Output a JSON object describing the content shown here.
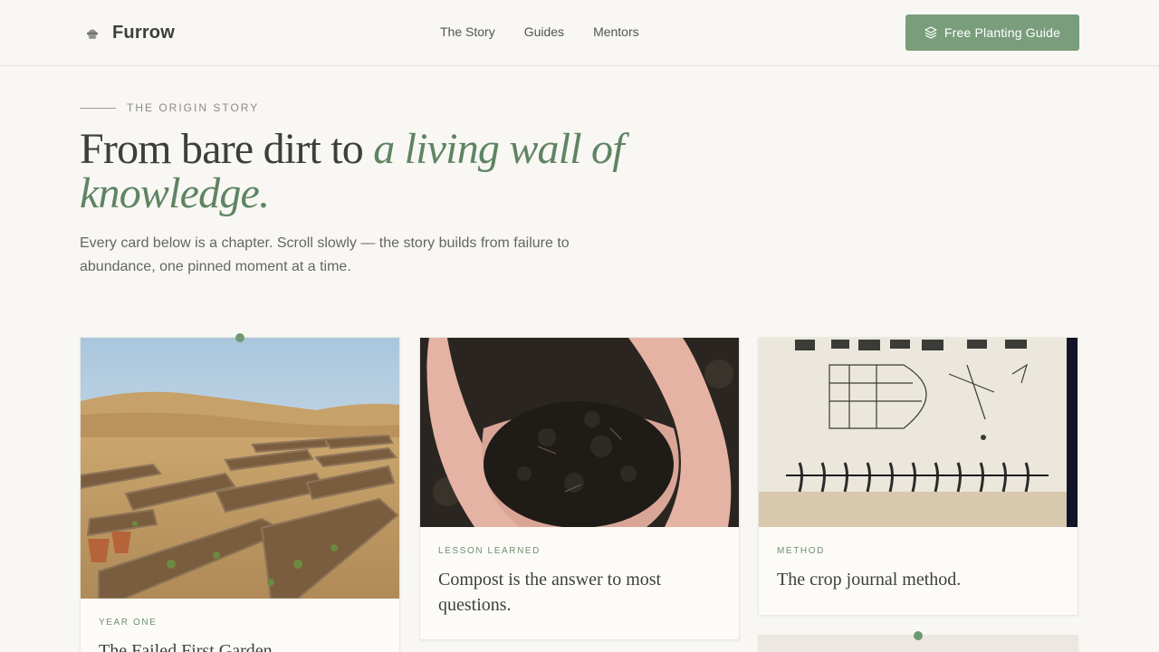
{
  "header": {
    "brand": "Furrow",
    "nav": [
      {
        "label": "The Story"
      },
      {
        "label": "Guides"
      },
      {
        "label": "Mentors"
      }
    ],
    "cta_label": "Free Planting Guide"
  },
  "hero": {
    "eyebrow": "THE ORIGIN STORY",
    "headline_plain": "From bare dirt to ",
    "headline_accent": "a living wall of knowledge.",
    "lede": "Every card below is a chapter. Scroll slowly — the story builds from failure to abundance, one pinned moment at a time."
  },
  "cards": [
    {
      "tag": "YEAR ONE",
      "title": "The Failed First Garden",
      "image": "dry-raised-garden-beds-photo"
    },
    {
      "tag": "LESSON LEARNED",
      "title": "Compost is the answer to most questions.",
      "image": "hands-holding-compost-photo"
    },
    {
      "tag": "METHOD",
      "title": "The crop journal method.",
      "image": "notebook-garden-sketch-photo"
    }
  ],
  "colors": {
    "accent": "#7a9d7c",
    "accent_dark": "#5f8463",
    "background": "#f8f7f3",
    "text": "#3f3f3a"
  }
}
